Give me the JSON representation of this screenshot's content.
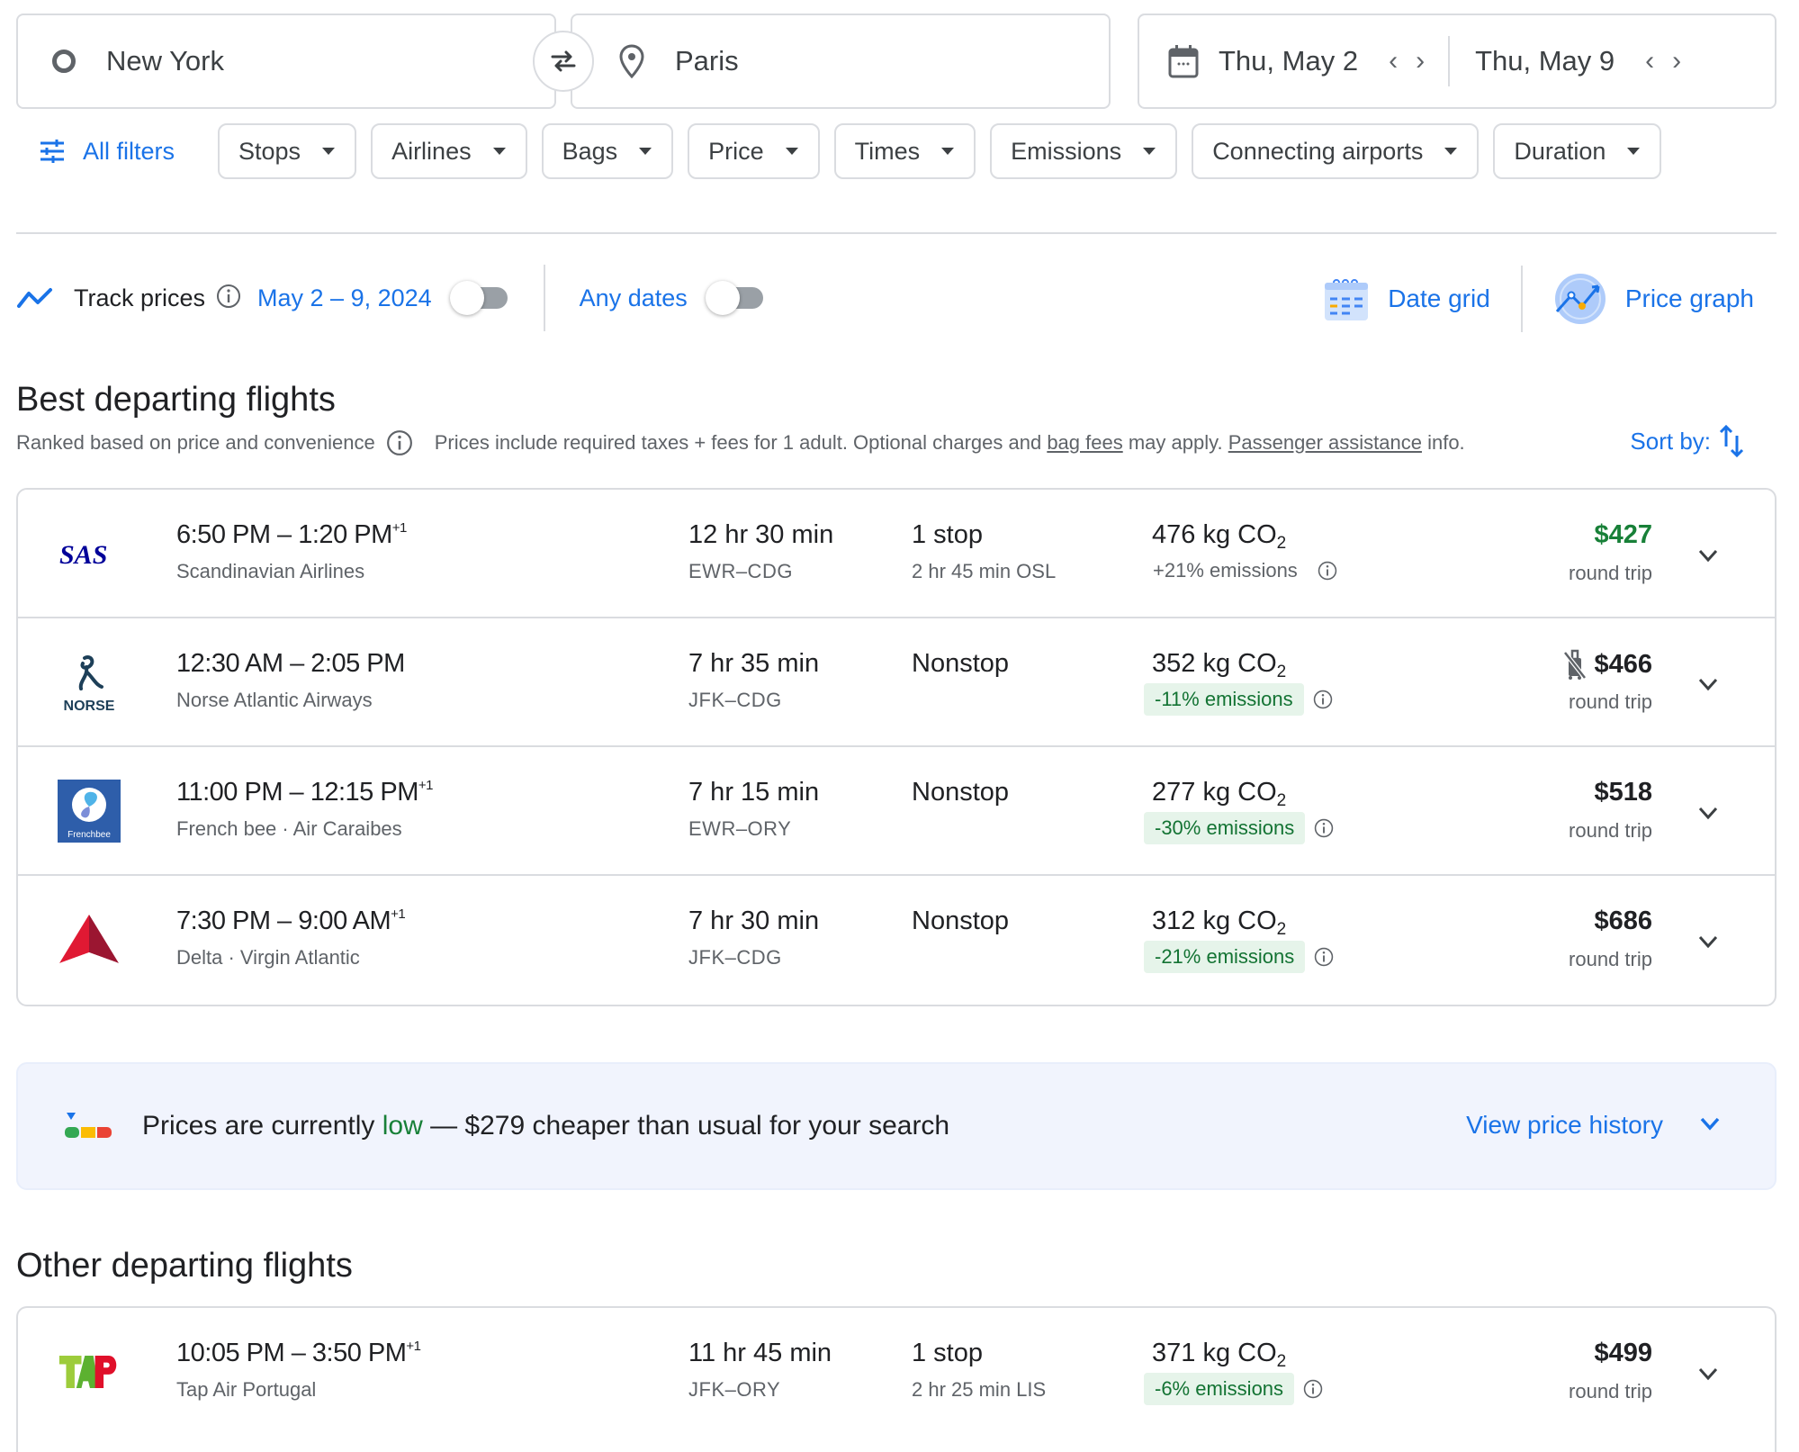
{
  "search": {
    "origin": "New York",
    "destination": "Paris",
    "depart_date": "Thu, May 2",
    "return_date": "Thu, May 9"
  },
  "filters": {
    "all_filters_label": "All filters",
    "chips": [
      "Stops",
      "Airlines",
      "Bags",
      "Price",
      "Times",
      "Emissions",
      "Connecting airports",
      "Duration"
    ]
  },
  "tracking": {
    "label": "Track prices",
    "date_range": "May 2 – 9, 2024",
    "date_range_toggle_on": false,
    "any_dates_label": "Any dates",
    "any_dates_toggle_on": false
  },
  "views": {
    "date_grid": "Date grid",
    "price_graph": "Price graph"
  },
  "best": {
    "title": "Best departing flights",
    "ranked_note": "Ranked based on price and convenience",
    "price_note_1": "Prices include required taxes + fees for 1 adult. Optional charges and",
    "bag_fees_link": "bag fees",
    "price_note_2": "may apply.",
    "passenger_link": "Passenger assistance",
    "price_note_3": "info.",
    "sort_label": "Sort by:",
    "flights": [
      {
        "logo": "SAS",
        "depart": "6:50 PM",
        "arrive": "1:20 PM",
        "day_offset": "+1",
        "airline": "Scandinavian Airlines",
        "duration": "12 hr 30 min",
        "route": "EWR–CDG",
        "stops": "1 stop",
        "layover": "2 hr 45 min OSL",
        "co2_value": "476 kg CO",
        "co2_sub": "2",
        "emissions": "+21% emissions",
        "emissions_type": "bad",
        "price": "$427",
        "price_color": "#188038",
        "price_type": "round trip",
        "no_carry_on": false
      },
      {
        "logo": "NORSE",
        "depart": "12:30 AM",
        "arrive": "2:05 PM",
        "day_offset": "",
        "airline": "Norse Atlantic Airways",
        "duration": "7 hr 35 min",
        "route": "JFK–CDG",
        "stops": "Nonstop",
        "layover": "",
        "co2_value": "352 kg CO",
        "co2_sub": "2",
        "emissions": "-11% emissions",
        "emissions_type": "good",
        "price": "$466",
        "price_color": "#202124",
        "price_type": "round trip",
        "no_carry_on": true
      },
      {
        "logo": "Frenchbee",
        "depart": "11:00 PM",
        "arrive": "12:15 PM",
        "day_offset": "+1",
        "airline": "French bee · Air Caraibes",
        "duration": "7 hr 15 min",
        "route": "EWR–ORY",
        "stops": "Nonstop",
        "layover": "",
        "co2_value": "277 kg CO",
        "co2_sub": "2",
        "emissions": "-30% emissions",
        "emissions_type": "good",
        "price": "$518",
        "price_color": "#202124",
        "price_type": "round trip",
        "no_carry_on": false
      },
      {
        "logo": "Delta",
        "depart": "7:30 PM",
        "arrive": "9:00 AM",
        "day_offset": "+1",
        "airline": "Delta · Virgin Atlantic",
        "duration": "7 hr 30 min",
        "route": "JFK–CDG",
        "stops": "Nonstop",
        "layover": "",
        "co2_value": "312 kg CO",
        "co2_sub": "2",
        "emissions": "-21% emissions",
        "emissions_type": "good",
        "price": "$686",
        "price_color": "#202124",
        "price_type": "round trip",
        "no_carry_on": false
      }
    ]
  },
  "insight": {
    "text_before": "Prices are currently ",
    "level": "low",
    "text_after": " — $279 cheaper than usual for your search",
    "link": "View price history"
  },
  "other": {
    "title": "Other departing flights",
    "flights": [
      {
        "logo": "TAP",
        "depart": "10:05 PM",
        "arrive": "3:50 PM",
        "day_offset": "+1",
        "airline": "Tap Air Portugal",
        "duration": "11 hr 45 min",
        "route": "JFK–ORY",
        "stops": "1 stop",
        "layover": "2 hr 25 min LIS",
        "co2_value": "371 kg CO",
        "co2_sub": "2",
        "emissions": "-6% emissions",
        "emissions_type": "good",
        "price": "$499",
        "price_color": "#202124",
        "price_type": "round trip",
        "no_carry_on": false
      }
    ]
  },
  "colors": {
    "accent": "#1a73e8",
    "good_green": "#188038",
    "good_badge_bg": "#e6f4ea",
    "banner_bg": "#f1f4fd"
  }
}
